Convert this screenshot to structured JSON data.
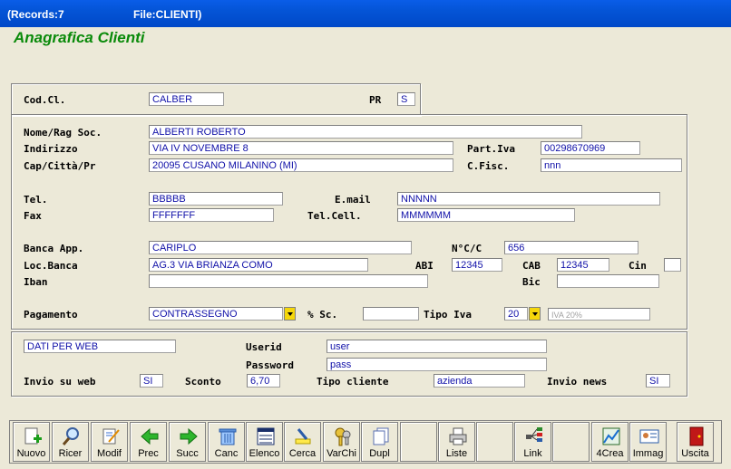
{
  "window": {
    "records": "(Records:7",
    "file": "File:CLIENTI)"
  },
  "heading": "Anagrafica Clienti",
  "top": {
    "cod_label": "Cod.Cl.",
    "cod_value": "CALBER",
    "pr_label": "PR",
    "pr_value": "S"
  },
  "form": {
    "nome_label": "Nome/Rag Soc.",
    "nome_value": "ALBERTI ROBERTO",
    "indirizzo_label": "Indirizzo",
    "indirizzo_value": "VIA IV NOVEMBRE 8",
    "partiva_label": "Part.Iva",
    "partiva_value": "00298670969",
    "cap_label": "Cap/Città/Pr",
    "cap_value": "20095 CUSANO MILANINO (MI)",
    "cfisc_label": "C.Fisc.",
    "cfisc_value": "nnn",
    "tel_label": "Tel.",
    "tel_value": "BBBBB",
    "email_label": "E.mail",
    "email_value": "NNNNN",
    "fax_label": "Fax",
    "fax_value": "FFFFFFF",
    "telcell_label": "Tel.Cell.",
    "telcell_value": "MMMMMM",
    "banca_label": "Banca App.",
    "banca_value": "CARIPLO",
    "ncc_label": "N°C/C",
    "ncc_value": "656",
    "locbanca_label": "Loc.Banca",
    "locbanca_value": "AG.3 VIA BRIANZA COMO",
    "abi_label": "ABI",
    "abi_value": "12345",
    "cab_label": "CAB",
    "cab_value": "12345",
    "cin_label": "Cin",
    "cin_value": "",
    "iban_label": "Iban",
    "iban_value": "",
    "bic_label": "Bic",
    "bic_value": "",
    "pagamento_label": "Pagamento",
    "pagamento_value": "CONTRASSEGNO",
    "sc_label": "% Sc.",
    "sc_value": "",
    "tipoiva_label": "Tipo Iva",
    "tipoiva_value": "20",
    "tipoiva_desc": "IVA 20%"
  },
  "web": {
    "dati_value": "DATI PER WEB",
    "userid_label": "Userid",
    "userid_value": "user",
    "password_label": "Password",
    "password_value": "pass",
    "invio_label": "Invio su web",
    "invio_value": "SI",
    "sconto_label": "Sconto",
    "sconto_value": "6,70",
    "tipocliente_label": "Tipo cliente",
    "tipocliente_value": "azienda",
    "invionews_label": "Invio news",
    "invionews_value": "SI"
  },
  "toolbar": {
    "nuovo": "Nuovo",
    "ricer": "Ricer",
    "modif": "Modif",
    "prec": "Prec",
    "succ": "Succ",
    "canc": "Canc",
    "elenco": "Elenco",
    "cerca": "Cerca",
    "varchi": "VarChi",
    "dupl": "Dupl",
    "liste": "Liste",
    "link": "Link",
    "crea4": "4Crea",
    "immag": "Immag",
    "uscita": "Uscita"
  }
}
